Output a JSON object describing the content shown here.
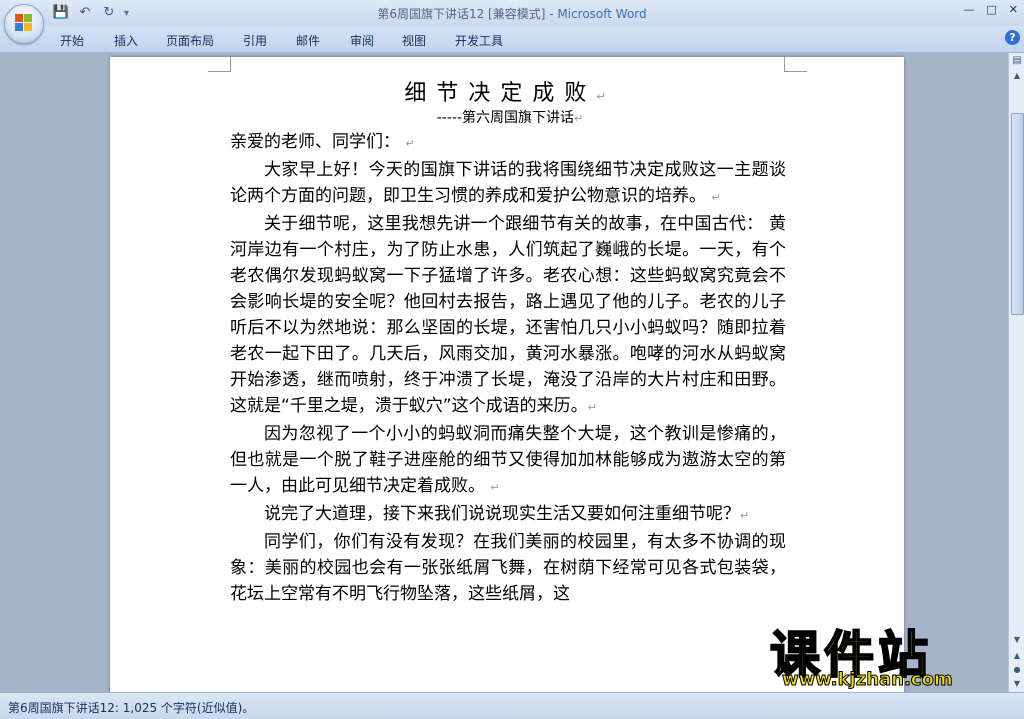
{
  "window": {
    "title_doc": "第6周国旗下讲话12 [兼容模式] - ",
    "title_app": "Microsoft Word",
    "min_label": "—",
    "max_label": "□",
    "close_label": "✕"
  },
  "qat": {
    "save_icon": "💾",
    "undo_icon": "↶",
    "redo_icon": "↻",
    "customize_icon": "▾"
  },
  "ribbon": {
    "tabs": [
      "开始",
      "插入",
      "页面布局",
      "引用",
      "邮件",
      "审阅",
      "视图",
      "开发工具"
    ],
    "help_label": "?"
  },
  "document": {
    "title": "细节决定成败",
    "subtitle": "-----第六周国旗下讲话",
    "mark": "↵",
    "salutation": "亲爱的老师、同学们：",
    "paragraphs": [
      "大家早上好！今天的国旗下讲话的我将围绕细节决定成败这一主题谈论两个方面的问题，即卫生习惯的养成和爱护公物意识的培养。",
      "关于细节呢，这里我想先讲一个跟细节有关的故事，在中国古代：  黄河岸边有一个村庄，为了防止水患，人们筑起了巍峨的长堤。一天，有个老农偶尔发现蚂蚁窝一下子猛增了许多。老农心想：这些蚂蚁窝究竟会不会影响长堤的安全呢？他回村去报告，路上遇见了他的儿子。老农的儿子听后不以为然地说：那么坚固的长堤，还害怕几只小小蚂蚁吗？随即拉着老农一起下田了。几天后，风雨交加，黄河水暴涨。咆哮的河水从蚂蚁窝开始渗透，继而喷射，终于冲溃了长堤，淹没了沿岸的大片村庄和田野。这就是“千里之堤，溃于蚁穴”这个成语的来历。",
      "因为忽视了一个小小的蚂蚁洞而痛失整个大堤，这个教训是惨痛的，但也就是一个脱了鞋子进座舱的细节又使得加加林能够成为遨游太空的第一人，由此可见细节决定着成败。",
      "说完了大道理，接下来我们说说现实生活又要如何注重细节呢？",
      "同学们，你们有没有发现？在我们美丽的校园里，有太多不协调的现象：美丽的校园也会有一张张纸屑飞舞，在树荫下经常可见各式包装袋，花坛上空常有不明飞行物坠落，这些纸屑，这"
    ]
  },
  "statusbar": {
    "text": "第6周国旗下讲话12: 1,025 个字符(近似值)。"
  },
  "watermark": {
    "brand": "课件站",
    "url": "www.kjzhan.com"
  }
}
